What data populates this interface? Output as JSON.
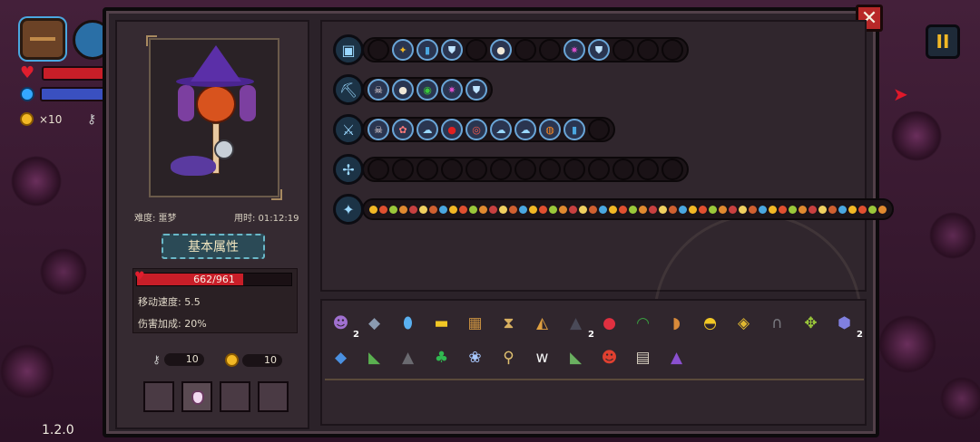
{
  "hud": {
    "coin_count": "×10",
    "version": "1.2.0",
    "pause_symbol": "II",
    "close_symbol": "✕"
  },
  "character": {
    "difficulty_label": "难度: 噩梦",
    "time_label": "用时: 01:12:19",
    "section_title": "基本属性",
    "hp": {
      "current": 662,
      "max": 961,
      "text": "662/961"
    },
    "move_speed": "移动速度: 5.5",
    "damage_bonus": "伤害加成: 20%",
    "keys": "10",
    "coins": "10"
  },
  "weapon_rows": [
    {
      "icon": "treasure-chest-icon",
      "bubbles": [
        {
          "icon": "empty"
        },
        {
          "icon": "gold-shell",
          "glyph": "✦",
          "color": "#f2b825"
        },
        {
          "icon": "blue-vial",
          "glyph": "▮",
          "color": "#4aa7e0"
        },
        {
          "icon": "ice-shield",
          "glyph": "⛊",
          "color": "#bfe4ff"
        },
        {
          "icon": "empty"
        },
        {
          "icon": "mouse",
          "glyph": "●",
          "color": "#f0e8d8"
        },
        {
          "icon": "empty"
        },
        {
          "icon": "empty"
        },
        {
          "icon": "purple-swirl",
          "glyph": "✷",
          "color": "#e050d0"
        },
        {
          "icon": "ice-shield",
          "glyph": "⛊",
          "color": "#bfe4ff"
        },
        {
          "icon": "empty"
        },
        {
          "icon": "empty"
        },
        {
          "icon": "empty"
        }
      ]
    },
    {
      "icon": "pickaxe-icon",
      "bubbles": [
        {
          "icon": "skull",
          "glyph": "☠",
          "color": "#f0e0e0"
        },
        {
          "icon": "mouse",
          "glyph": "●",
          "color": "#f0e8d8"
        },
        {
          "icon": "green-slime",
          "glyph": "◉",
          "color": "#3ac83a"
        },
        {
          "icon": "purple-swirl",
          "glyph": "✷",
          "color": "#e050d0"
        },
        {
          "icon": "ice-shield",
          "glyph": "⛊",
          "color": "#bfe4ff"
        }
      ]
    },
    {
      "icon": "crystal-sword-icon",
      "bubbles": [
        {
          "icon": "skull",
          "glyph": "☠",
          "color": "#f0e0e0"
        },
        {
          "icon": "flower",
          "glyph": "✿",
          "color": "#ff7a7a"
        },
        {
          "icon": "ghost",
          "glyph": "☁",
          "color": "#9ad8ff"
        },
        {
          "icon": "cherry",
          "glyph": "●",
          "color": "#e02020"
        },
        {
          "icon": "target",
          "glyph": "◎",
          "color": "#ff5a4a"
        },
        {
          "icon": "ghost",
          "glyph": "☁",
          "color": "#9ad8ff"
        },
        {
          "icon": "ghost",
          "glyph": "☁",
          "color": "#9ad8ff"
        },
        {
          "icon": "orange-charm",
          "glyph": "◍",
          "color": "#ff8a20"
        },
        {
          "icon": "blue-vial",
          "glyph": "▮",
          "color": "#4aa7e0"
        },
        {
          "icon": "empty"
        }
      ]
    },
    {
      "icon": "staff-icon",
      "bubbles": [
        {
          "icon": "empty"
        },
        {
          "icon": "empty"
        },
        {
          "icon": "empty"
        },
        {
          "icon": "empty"
        },
        {
          "icon": "empty"
        },
        {
          "icon": "empty"
        },
        {
          "icon": "empty"
        },
        {
          "icon": "empty"
        },
        {
          "icon": "empty"
        },
        {
          "icon": "empty"
        },
        {
          "icon": "empty"
        },
        {
          "icon": "empty"
        },
        {
          "icon": "empty"
        }
      ]
    },
    {
      "icon": "magic-wand-icon",
      "tiny": true
    }
  ],
  "inventory": [
    {
      "name": "witch-portrait",
      "glyph": "☻",
      "color": "#a070d0",
      "count": "2"
    },
    {
      "name": "stone-boot",
      "glyph": "◆",
      "color": "#8a9ab0"
    },
    {
      "name": "mirror",
      "glyph": "⬮",
      "color": "#5ab0f0"
    },
    {
      "name": "battery",
      "glyph": "▬",
      "color": "#f2c825"
    },
    {
      "name": "ancient-book",
      "glyph": "▦",
      "color": "#c89040"
    },
    {
      "name": "hourglass",
      "glyph": "⧗",
      "color": "#d8b060"
    },
    {
      "name": "pizza-slice",
      "glyph": "◭",
      "color": "#e0a040"
    },
    {
      "name": "dark-cloak",
      "glyph": "▲",
      "color": "#4a4a58",
      "count": "2"
    },
    {
      "name": "strawberry",
      "glyph": "●",
      "color": "#e03040"
    },
    {
      "name": "green-bra",
      "glyph": "◠",
      "color": "#3aa040"
    },
    {
      "name": "bread",
      "glyph": "◗",
      "color": "#d88a3a"
    },
    {
      "name": "golden-bell",
      "glyph": "◓",
      "color": "#f2c825"
    },
    {
      "name": "gold-frame",
      "glyph": "◈",
      "color": "#e0b830"
    },
    {
      "name": "gravestone",
      "glyph": "∩",
      "color": "#7a7a80"
    },
    {
      "name": "green-lamp",
      "glyph": "✥",
      "color": "#9ac83a"
    },
    {
      "name": "purple-potion",
      "glyph": "⬢",
      "color": "#8080e0",
      "count": "2"
    },
    {
      "name": "blue-drop",
      "glyph": "◆",
      "color": "#4a90e0"
    },
    {
      "name": "green-shoe",
      "glyph": "◣",
      "color": "#5ab050"
    },
    {
      "name": "gray-cloak",
      "glyph": "▲",
      "color": "#6a6a70"
    },
    {
      "name": "clover",
      "glyph": "♣",
      "color": "#30b850"
    },
    {
      "name": "lotus",
      "glyph": "❀",
      "color": "#a8c8ff"
    },
    {
      "name": "magnifier",
      "glyph": "⚲",
      "color": "#e0c070"
    },
    {
      "name": "fangs",
      "glyph": "ᴡ",
      "color": "#f0f0f0"
    },
    {
      "name": "green-boot",
      "glyph": "◣",
      "color": "#6ab060"
    },
    {
      "name": "demon-mask",
      "glyph": "☻",
      "color": "#e04030"
    },
    {
      "name": "rib-cage",
      "glyph": "▤",
      "color": "#d8d0c0"
    },
    {
      "name": "witch-hat",
      "glyph": "▲",
      "color": "#8a50d0"
    }
  ]
}
